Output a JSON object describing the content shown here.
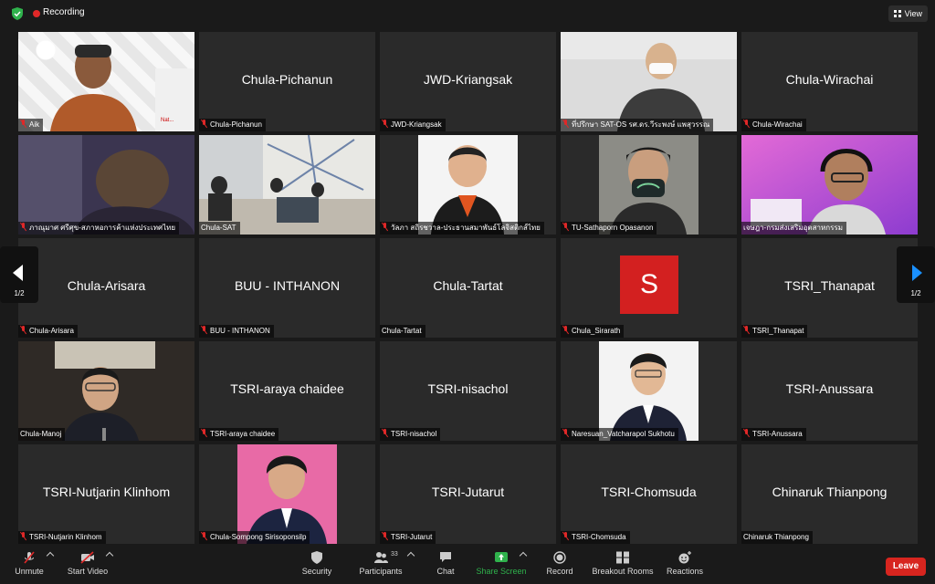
{
  "topbar": {
    "recording_label": "Recording",
    "view_label": "View"
  },
  "pagination": {
    "left": "1/2",
    "right": "1/2"
  },
  "tiles": [
    {
      "name": "Aik",
      "display": ""
    },
    {
      "name": "Chula-Pichanun",
      "display": "Chula-Pichanun"
    },
    {
      "name": "JWD-Kriangsak",
      "display": "JWD-Kriangsak"
    },
    {
      "name": "ที่ปรึกษา SAT-OS รศ.ดร.วีระพงษ์ แพสุวรรณ",
      "display": ""
    },
    {
      "name": "Chula-Wirachai",
      "display": "Chula-Wirachai"
    },
    {
      "name": "ภาณุมาศ ศรีศุข-สภาหอการค้าแห่งประเทศไทย",
      "display": ""
    },
    {
      "name": "Chula-SAT",
      "display": ""
    },
    {
      "name": "วัลภา สถิรชวาล-ประธานสมาพันธ์โลจิสติกส์ไทย",
      "display": ""
    },
    {
      "name": "TU-Sathaporn Opasanon",
      "display": ""
    },
    {
      "name": "เจษฎา-กรมส่งเสริมอุตสาหกรรม",
      "display": ""
    },
    {
      "name": "Chula-Arisara",
      "display": "Chula-Arisara"
    },
    {
      "name": "BUU - INTHANON",
      "display": "BUU - INTHANON"
    },
    {
      "name": "Chula-Tartat",
      "display": "Chula-Tartat"
    },
    {
      "name": "Chula_Sirarath",
      "display": "",
      "avatar": "S"
    },
    {
      "name": "TSRI_Thanapat",
      "display": "TSRI_Thanapat"
    },
    {
      "name": "Chula-Manoj",
      "display": ""
    },
    {
      "name": "TSRI-araya chaidee",
      "display": "TSRI-araya chaidee"
    },
    {
      "name": "TSRI-nisachol",
      "display": "TSRI-nisachol"
    },
    {
      "name": "Naresuan_Vatcharapol Sukhotu",
      "display": ""
    },
    {
      "name": "TSRI-Anussara",
      "display": "TSRI-Anussara"
    },
    {
      "name": "TSRI-Nutjarin Klinhom",
      "display": "TSRI-Nutjarin Klinhom"
    },
    {
      "name": "Chula-Sompong Sirisoponsilp",
      "display": ""
    },
    {
      "name": "TSRI-Jutarut",
      "display": "TSRI-Jutarut"
    },
    {
      "name": "TSRI-Chomsuda",
      "display": "TSRI-Chomsuda"
    },
    {
      "name": "Chinaruk Thianpong",
      "display": "Chinaruk Thianpong"
    }
  ],
  "toolbar": {
    "unmute": "Unmute",
    "start_video": "Start Video",
    "security": "Security",
    "participants": "Participants",
    "participants_count": "33",
    "chat": "Chat",
    "share_screen": "Share Screen",
    "record": "Record",
    "breakout_rooms": "Breakout Rooms",
    "reactions": "Reactions",
    "leave": "Leave"
  },
  "colors": {
    "accent_green": "#2fb24c",
    "leave_red": "#d7251f",
    "recording_red": "#e02828",
    "active_speaker": "#c7d96a"
  }
}
